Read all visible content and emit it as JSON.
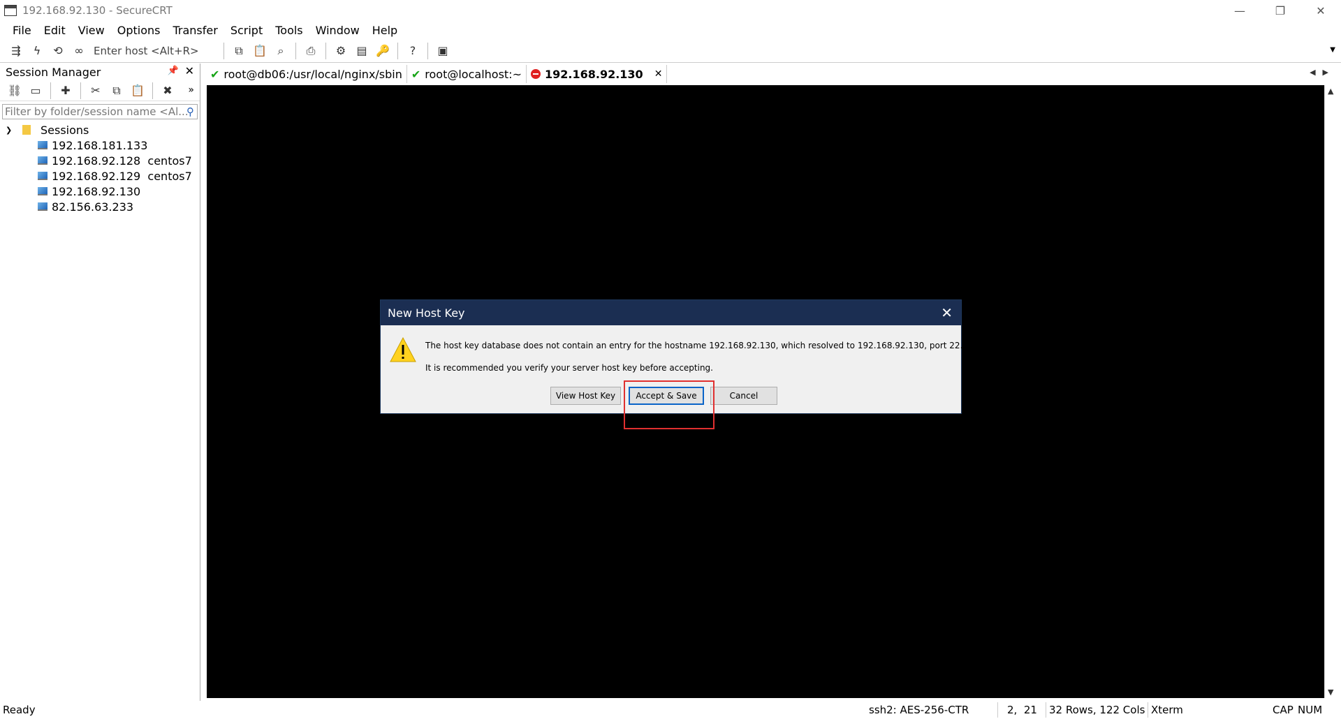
{
  "window": {
    "title": "192.168.92.130 - SecureCRT",
    "minimize": "—",
    "restore": "❐",
    "close": "✕"
  },
  "menu": [
    "File",
    "Edit",
    "View",
    "Options",
    "Transfer",
    "Script",
    "Tools",
    "Window",
    "Help"
  ],
  "toolbar": {
    "quick_connect_placeholder": "Enter host <Alt+R>"
  },
  "session_manager": {
    "title": "Session Manager",
    "pin": "📌",
    "close": "✕",
    "filter_placeholder": "Filter by folder/session name <Al...",
    "root": "Sessions",
    "sessions": [
      "192.168.181.133",
      "192.168.92.128  centos7",
      "192.168.92.129  centos7",
      "192.168.92.130",
      "82.156.63.233"
    ]
  },
  "tabs": [
    {
      "label": "root@db06:/usr/local/nginx/sbin",
      "status": "connected"
    },
    {
      "label": "root@localhost:~",
      "status": "connected"
    },
    {
      "label": "192.168.92.130",
      "status": "disconnected"
    }
  ],
  "dialog": {
    "title": "New Host Key",
    "message": "The host key database does not contain an entry for the hostname 192.168.92.130, which resolved to 192.168.92.130, port 22.",
    "recommendation": "It is recommended you verify your server host key before accepting.",
    "buttons": {
      "view": "View Host Key",
      "accept": "Accept & Save",
      "cancel": "Cancel"
    }
  },
  "status": {
    "ready": "Ready",
    "cipher": "ssh2: AES-256-CTR",
    "cursor": "2,  21",
    "size": "32 Rows, 122 Cols",
    "term": "Xterm",
    "cap": "CAP",
    "num": "NUM"
  }
}
